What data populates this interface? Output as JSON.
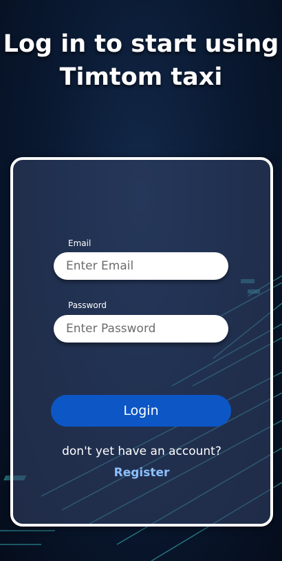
{
  "header": {
    "title": "Log in to start using Timtom taxi"
  },
  "form": {
    "email": {
      "label": "Email",
      "placeholder": "Enter Email",
      "value": ""
    },
    "password": {
      "label": "Password",
      "placeholder": "Enter Password",
      "value": ""
    },
    "login_label": "Login",
    "no_account_text": "don't yet have an account?",
    "register_label": "Register"
  },
  "colors": {
    "background": "#0a1a33",
    "card_border": "#ffffff",
    "login_button": "#0c56c6",
    "register_link": "#8cc0ff",
    "circuit_lines": "#3fc4c8"
  }
}
